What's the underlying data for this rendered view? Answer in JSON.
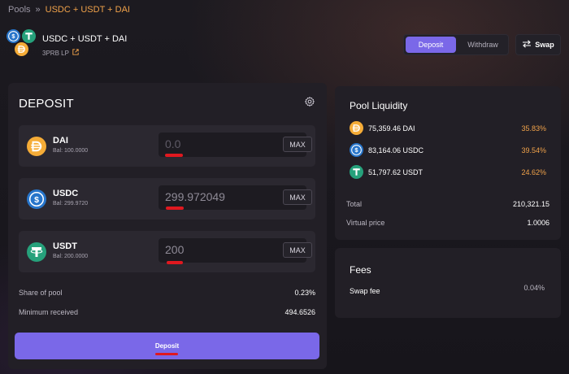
{
  "breadcrumb": {
    "root": "Pools",
    "separator": "»",
    "current": "USDC + USDT + DAI"
  },
  "pool": {
    "title": "USDC + USDT + DAI",
    "lp_token": "3PRB LP"
  },
  "tabs": [
    {
      "label": "Deposit",
      "active": true
    },
    {
      "label": "Withdraw",
      "active": false
    }
  ],
  "swap_button": {
    "label": "Swap"
  },
  "deposit": {
    "title": "DEPOSIT",
    "tokens": [
      {
        "symbol": "DAI",
        "balance": "Bal: 100.0000",
        "placeholder": "0.0",
        "value": "",
        "max_label": "MAX",
        "icon": "dai-icon"
      },
      {
        "symbol": "USDC",
        "balance": "Bal: 299.9720",
        "placeholder": "0.0",
        "value": "299.972049",
        "max_label": "MAX",
        "icon": "usdc-icon"
      },
      {
        "symbol": "USDT",
        "balance": "Bal: 200.0000",
        "placeholder": "0.0",
        "value": "200",
        "max_label": "MAX",
        "icon": "usdt-icon"
      }
    ],
    "share_of_pool": {
      "label": "Share of pool",
      "value": "0.23%"
    },
    "minimum_received": {
      "label": "Minimum received",
      "value": "494.6526"
    },
    "button_label": "Deposit"
  },
  "liquidity": {
    "title": "Pool Liquidity",
    "assets": [
      {
        "amount": "75,359.46 DAI",
        "percent": "35.83%",
        "icon": "dai-icon"
      },
      {
        "amount": "83,164.06 USDC",
        "percent": "39.54%",
        "icon": "usdc-icon"
      },
      {
        "amount": "51,797.62 USDT",
        "percent": "24.62%",
        "icon": "usdt-icon"
      }
    ],
    "total": {
      "label": "Total",
      "value": "210,321.15"
    },
    "virtual_price": {
      "label": "Virtual price",
      "value": "1.0006"
    }
  },
  "fees": {
    "title": "Fees",
    "swap_fee": {
      "label": "Swap fee",
      "value": "0.04%"
    }
  },
  "colors": {
    "accent": "#7a68e8",
    "highlight": "#f0a24a",
    "dai": "#f5ac37",
    "usdc": "#2775ca",
    "usdt": "#26a17b",
    "annotation": "#e0181f"
  }
}
